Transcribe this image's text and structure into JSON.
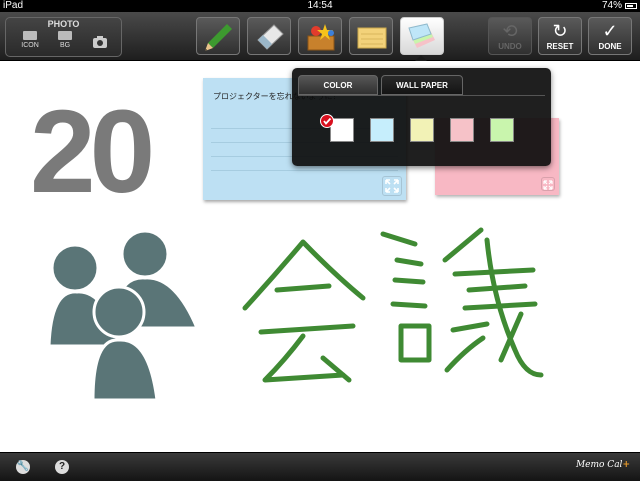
{
  "status_bar": {
    "device": "iPad",
    "time": "14:54",
    "battery": "74%"
  },
  "toolbar": {
    "photo_group": {
      "title": "PHOTO",
      "icon_label": "ICON",
      "bg_label": "BG"
    },
    "tools": [
      "pencil-icon",
      "eraser-icon",
      "stamp-box-icon",
      "memo-pad-icon",
      "paper-color-icon"
    ],
    "undo_label": "UNDO",
    "reset_label": "RESET",
    "done_label": "DONE"
  },
  "canvas": {
    "big_number": "20",
    "handwriting": "会議",
    "memo_blue_text": "プロジェクターを忘れないように！"
  },
  "popup": {
    "tabs": [
      "COLOR",
      "WALL PAPER"
    ],
    "active_tab": "COLOR",
    "swatches": [
      "#ffffff",
      "#c6eefc",
      "#f2f2b6",
      "#f6c2c8",
      "#c9f5ad"
    ],
    "selected_swatch": "#ffffff"
  },
  "bottom_bar": {
    "brand": "Memo Cal",
    "settings_icon": "wrench-icon",
    "help_icon": "question-icon"
  }
}
